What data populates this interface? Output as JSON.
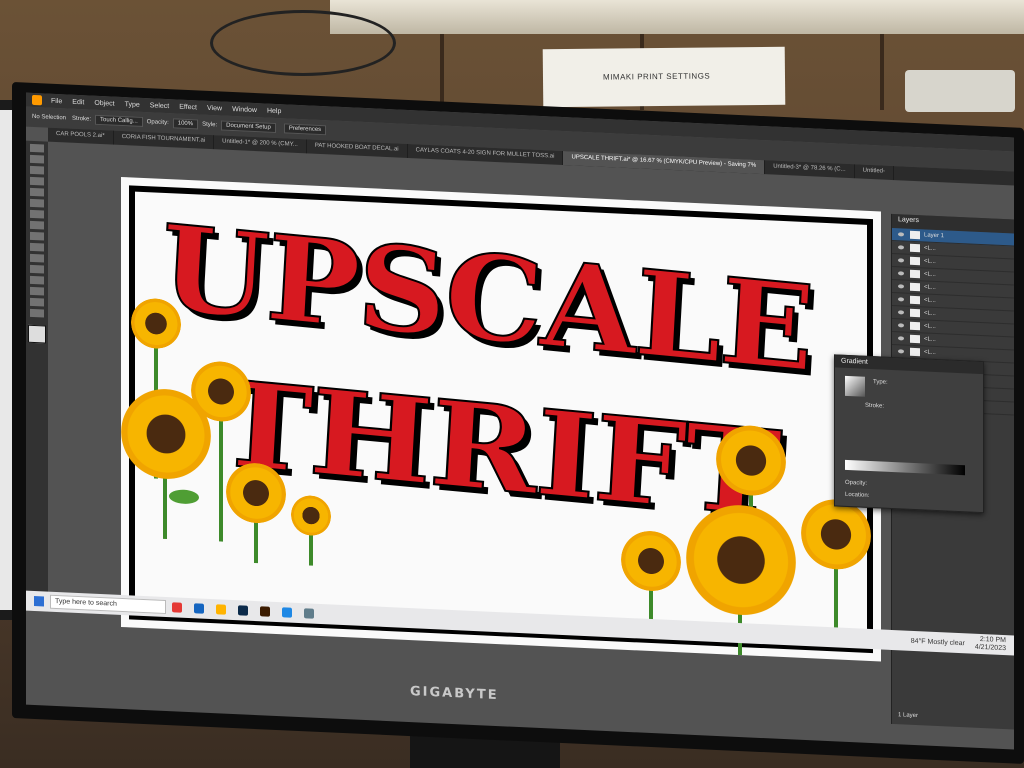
{
  "wall_note": "MIMAKI PRINT SETTINGS",
  "monitor_brand": "GIGABYTE",
  "app": {
    "menus": [
      "File",
      "Edit",
      "Object",
      "Type",
      "Select",
      "Effect",
      "View",
      "Window",
      "Help"
    ],
    "control_bar": {
      "selection": "No Selection",
      "stroke_label": "Stroke:",
      "brush": "Touch Callig...",
      "opacity_label": "Opacity:",
      "opacity_value": "100%",
      "style_label": "Style:",
      "document_setup": "Document Setup",
      "preferences": "Preferences"
    },
    "tabs": [
      {
        "label": "CAR POOLS 2.ai*"
      },
      {
        "label": "CORIA FISH TOURNAMENT.ai"
      },
      {
        "label": "Untitled-1* @ 200 % (CMY..."
      },
      {
        "label": "PAT HOOKED BOAT DECAL.ai"
      },
      {
        "label": "CAYLAS COATS 4-20 SIGN FOR MULLET TOSS.ai"
      },
      {
        "label": "UPSCALE THRIFT.ai* @ 16.67 % (CMYK/CPU Preview) - Saving 7%"
      },
      {
        "label": "Untitled-3* @ 78.26 % (C..."
      },
      {
        "label": "Untitled-"
      }
    ],
    "artwork": {
      "line1": "UPSCALE",
      "line2": "THRIFT"
    },
    "layers_panel": {
      "title": "Layers",
      "first_layer": "Layer 1",
      "sublayer": "<L...",
      "footer": "1 Layer"
    },
    "gradient_panel": {
      "title": "Gradient",
      "type_label": "Type:",
      "stroke_label": "Stroke:",
      "opacity_label": "Opacity:",
      "location_label": "Location:"
    },
    "taskbar": {
      "search_placeholder": "Type here to search",
      "weather": "84°F  Mostly clear",
      "time": "2:10 PM",
      "date": "4/21/2023"
    }
  },
  "colors": {
    "headline_red": "#d71920",
    "ui_dark": "#323232",
    "sunflower_yellow": "#f7b500"
  }
}
